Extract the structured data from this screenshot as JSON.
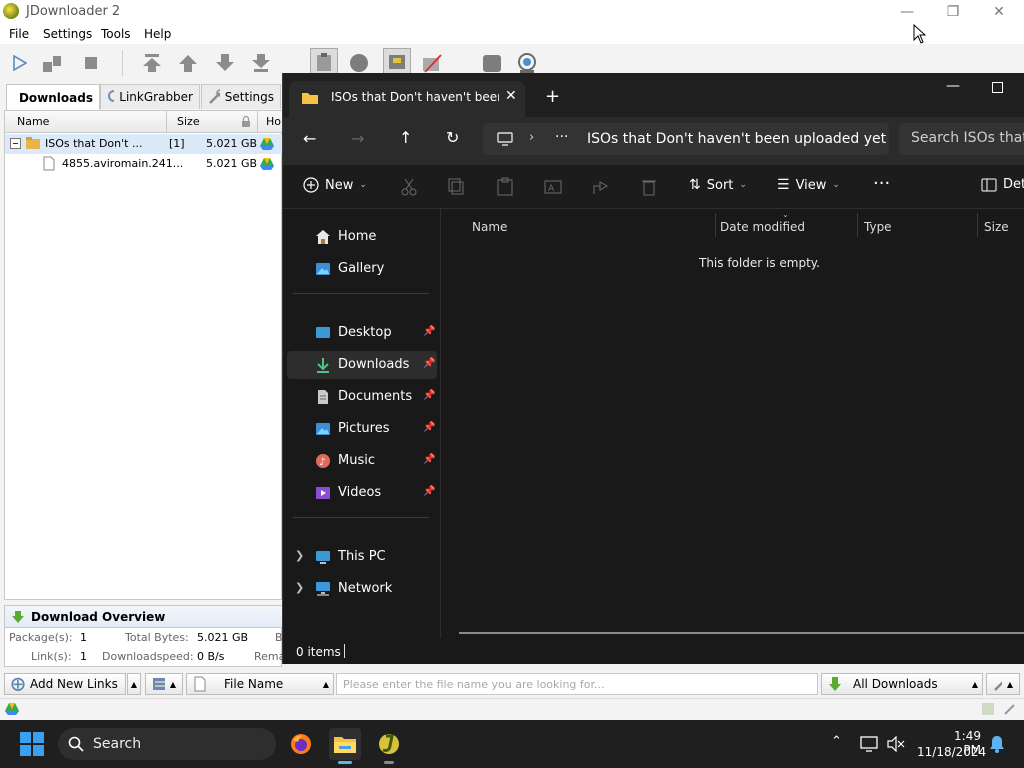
{
  "jdownloader": {
    "title": "JDownloader 2",
    "menu": [
      "File",
      "Settings",
      "Tools",
      "Help"
    ],
    "tabs": [
      {
        "label": "Downloads",
        "active": true
      },
      {
        "label": "LinkGrabber",
        "active": false
      },
      {
        "label": "Settings",
        "active": false
      }
    ],
    "table": {
      "headers": {
        "name": "Name",
        "size": "Size",
        "hoster": "Ho"
      },
      "rows": [
        {
          "type": "package",
          "name": "ISOs that Don't ...",
          "count": "[1]",
          "size": "5.021 GB"
        },
        {
          "type": "file",
          "name": "4855.aviromain.241...",
          "size": "5.021 GB"
        }
      ]
    },
    "overview": {
      "title": "Download Overview",
      "packages_label": "Package(s):",
      "packages_value": "1",
      "total_bytes_label": "Total Bytes:",
      "total_bytes_value": "5.021 GB",
      "links_label": "Link(s):",
      "links_value": "1",
      "speed_label": "Downloadspeed:",
      "speed_value": "0 B/s",
      "cut_right_1": "B",
      "cut_right_2": "Rema"
    },
    "bottombar": {
      "add_links": "Add New Links",
      "filter_column": "File Name",
      "search_placeholder": "Please enter the file name you are looking for...",
      "view_filter": "All Downloads"
    }
  },
  "explorer": {
    "tab_title": "ISOs that Don't haven't been uploaded yet",
    "address_path": "ISOs that Don't haven't been uploaded yet",
    "search_placeholder": "Search ISOs that Don't haven't been uploaded yet",
    "commands": {
      "new": "New",
      "sort": "Sort",
      "view": "View",
      "details": "Details"
    },
    "nav": {
      "home": "Home",
      "gallery": "Gallery",
      "desktop": "Desktop",
      "downloads": "Downloads",
      "documents": "Documents",
      "pictures": "Pictures",
      "music": "Music",
      "videos": "Videos",
      "this_pc": "This PC",
      "network": "Network"
    },
    "columns": {
      "name": "Name",
      "date": "Date modified",
      "type": "Type",
      "size": "Size"
    },
    "empty_message": "This folder is empty.",
    "status": "0 items"
  },
  "taskbar": {
    "search_label": "Search",
    "time": "1:49 PM",
    "date": "11/18/2024"
  },
  "colors": {
    "accent_blue": "#5fb2f2",
    "folder_yellow": "#f5c242",
    "jd_selection": "#dbe9f8",
    "explorer_bg": "#191919"
  }
}
